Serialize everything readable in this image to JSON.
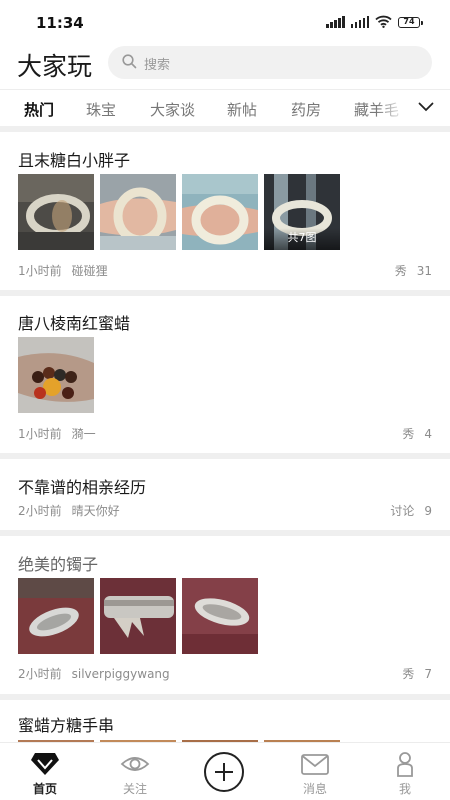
{
  "status": {
    "time": "11:34",
    "battery": "74"
  },
  "header": {
    "logo": "大家玩",
    "search_placeholder": "搜索"
  },
  "tabs": [
    "热门",
    "珠宝",
    "大家谈",
    "新帖",
    "药房",
    "藏羊毛"
  ],
  "posts": [
    {
      "title": "且末糖白小胖子",
      "time": "1小时前",
      "author": "碰碰狸",
      "category": "秀",
      "count": "31",
      "image_count_label": "共7图"
    },
    {
      "title": "唐八棱南红蜜蜡",
      "time": "1小时前",
      "author": "漪一",
      "category": "秀",
      "count": "4"
    },
    {
      "title": "不靠谱的相亲经历",
      "time": "2小时前",
      "author": "晴天你好",
      "category": "讨论",
      "count": "9"
    },
    {
      "title": "绝美的镯子",
      "time": "2小时前",
      "author": "silverpiggywang",
      "category": "秀",
      "count": "7"
    },
    {
      "title": "蜜蜡方糖手串"
    }
  ],
  "bottom_nav": [
    {
      "label": "首页",
      "icon": "diamond-home-icon",
      "active": true
    },
    {
      "label": "关注",
      "icon": "eye-icon",
      "active": false
    },
    {
      "label": "",
      "icon": "add-icon",
      "active": false
    },
    {
      "label": "消息",
      "icon": "mail-icon",
      "active": false
    },
    {
      "label": "我",
      "icon": "person-icon",
      "active": false
    }
  ],
  "colors": {
    "separator": "#efefef",
    "search_bg": "#f1f1f1",
    "meta_text": "#8c8c8c"
  }
}
